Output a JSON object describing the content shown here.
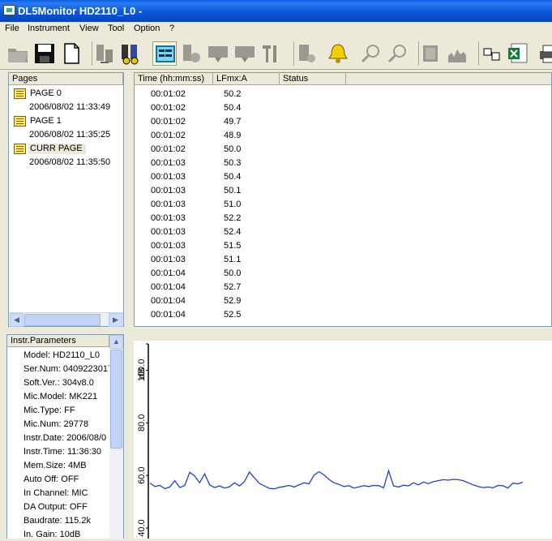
{
  "window": {
    "title": "DL5Monitor HD2110_L0 -"
  },
  "menu": [
    "File",
    "Instrument",
    "View",
    "Tool",
    "Option",
    "?"
  ],
  "toolbar": {
    "buttons": [
      "open-folder-icon",
      "save-icon",
      "new-document-icon",
      "instrument-connect-icon",
      "instrument-disconnect-icon",
      "display-monitor-icon",
      "instrument-settings-icon",
      "monitor-icon",
      "print-data-icon",
      "tools-icon",
      "instrument-config-icon",
      "alarm-bell-icon",
      "zoom-in-icon",
      "zoom-out-icon",
      "book-icon",
      "chart-icon",
      "table-icon",
      "excel-export-icon",
      "printer-icon"
    ]
  },
  "pages": {
    "header": "Pages",
    "items": [
      {
        "label": "PAGE 0",
        "date": "2006/08/02 11:33:49"
      },
      {
        "label": "PAGE 1",
        "date": "2006/08/02 11:35:25"
      },
      {
        "label": "CURR PAGE",
        "date": "2006/08/02 11:35:50"
      }
    ]
  },
  "table": {
    "columns": [
      "Time (hh:mm:ss)",
      "LFmx:A",
      "Status"
    ],
    "rows": [
      {
        "time": "00:01:02",
        "value": "50.2"
      },
      {
        "time": "00:01:02",
        "value": "50.4"
      },
      {
        "time": "00:01:02",
        "value": "49.7"
      },
      {
        "time": "00:01:02",
        "value": "48.9"
      },
      {
        "time": "00:01:02",
        "value": "50.0"
      },
      {
        "time": "00:01:03",
        "value": "50.3"
      },
      {
        "time": "00:01:03",
        "value": "50.4"
      },
      {
        "time": "00:01:03",
        "value": "50.1"
      },
      {
        "time": "00:01:03",
        "value": "51.0"
      },
      {
        "time": "00:01:03",
        "value": "52.2"
      },
      {
        "time": "00:01:03",
        "value": "52.4"
      },
      {
        "time": "00:01:03",
        "value": "51.5"
      },
      {
        "time": "00:01:03",
        "value": "51.1"
      },
      {
        "time": "00:01:04",
        "value": "50.0"
      },
      {
        "time": "00:01:04",
        "value": "52.7"
      },
      {
        "time": "00:01:04",
        "value": "52.9"
      },
      {
        "time": "00:01:04",
        "value": "52.5"
      }
    ]
  },
  "params": {
    "header": "Instr.Parameters",
    "items": [
      "Model: HD2110_L0",
      "Ser.Num: 0409223017",
      "Soft.Ver.: 304v8.0",
      "Mic.Model: MK221",
      "Mic.Type: FF",
      "Mic.Num: 29778",
      "Instr.Date: 2006/08/0",
      "Instr.Time: 11:36:30",
      "Mem.Size: 4MB",
      "Auto Off: OFF",
      "In Channel: MIC",
      "DA Output: OFF",
      "Baudrate: 115.2k",
      "In. Gain: 10dB"
    ]
  },
  "chart_data": {
    "type": "line",
    "ylabel": "dB",
    "y_ticks": [
      "40.0",
      "60.0",
      "80.0",
      "100.0"
    ],
    "ylim": [
      36,
      110
    ],
    "color": "#2040d0",
    "values": [
      57.1,
      55.8,
      56.2,
      55.0,
      55.6,
      58.0,
      55.4,
      56.2,
      61.2,
      59.8,
      57.2,
      60.6,
      56.4,
      55.4,
      56.0,
      55.2,
      55.7,
      57.2,
      56.0,
      57.6,
      61.3,
      59.1,
      57.0,
      56.0,
      55.1,
      54.9,
      55.5,
      55.8,
      56.2,
      55.6,
      56.4,
      57.2,
      56.8,
      60.1,
      61.4,
      60.2,
      58.5,
      57.2,
      56.6,
      55.8,
      56.1,
      55.2,
      55.6,
      56.1,
      55.8,
      56.2,
      56.1,
      55.3,
      61.8,
      56.0,
      55.6,
      56.3,
      56.0,
      57.2,
      56.4,
      57.5,
      56.9,
      57.6,
      58.0,
      58.4,
      58.2,
      58.5,
      58.4,
      58.0,
      57.2,
      56.4,
      55.8,
      55.4,
      55.6,
      55.3,
      56.2,
      56.1,
      55.2,
      57.1,
      56.8,
      57.4
    ]
  }
}
